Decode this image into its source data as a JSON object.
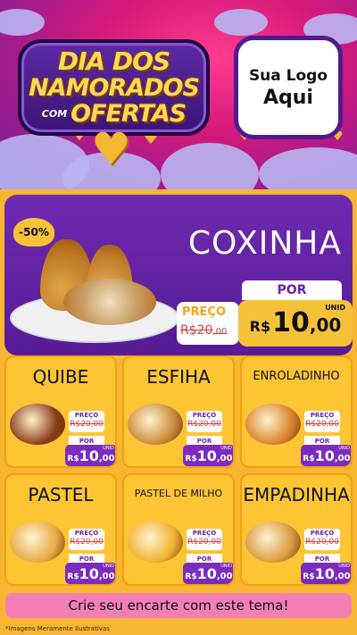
{
  "header": {
    "title_line1": "DIA DOS",
    "title_line2": "NAMORADOS",
    "title_small": "COM",
    "title_line3": "OFERTAS",
    "logo_line1": "Sua Logo",
    "logo_line2": "Aqui"
  },
  "featured": {
    "discount": "-50%",
    "name": "COXINHA",
    "preco_label": "PREÇO",
    "old_price_int": "R$20",
    "old_price_dec": ",00",
    "por_label": "POR",
    "currency": "R$",
    "new_price_int": "10",
    "new_price_dec": ",00",
    "unit": "UNID"
  },
  "products": [
    {
      "name": "QUIBE",
      "preco_label": "PREÇO",
      "old_price": "R$20,00",
      "por_label": "POR",
      "currency": "R$",
      "price_int": "10",
      "price_dec": ",00",
      "unit": "UNID",
      "food_color": "#8a3d18"
    },
    {
      "name": "ESFIHA",
      "preco_label": "PREÇO",
      "old_price": "R$20,00",
      "por_label": "POR",
      "currency": "R$",
      "price_int": "10",
      "price_dec": ",00",
      "unit": "UNID",
      "food_color": "#c98a3a"
    },
    {
      "name": "ENROLADINHO",
      "preco_label": "PREÇO",
      "old_price": "R$20,00",
      "por_label": "POR",
      "currency": "R$",
      "price_int": "10",
      "price_dec": ",00",
      "unit": "UNID",
      "food_color": "#d9822b"
    },
    {
      "name": "PASTEL",
      "preco_label": "PREÇO",
      "old_price": "R$20,00",
      "por_label": "POR",
      "currency": "R$",
      "price_int": "10",
      "price_dec": ",00",
      "unit": "UNID",
      "food_color": "#e8a845"
    },
    {
      "name": "PASTEL DE MILHO",
      "preco_label": "PREÇO",
      "old_price": "R$20,00",
      "por_label": "POR",
      "currency": "R$",
      "price_int": "10",
      "price_dec": ",00",
      "unit": "UNID",
      "food_color": "#f0b030"
    },
    {
      "name": "EMPADINHA",
      "preco_label": "PREÇO",
      "old_price": "R$20,00",
      "por_label": "POR",
      "currency": "R$",
      "price_int": "10",
      "price_dec": ",00",
      "unit": "UNID",
      "food_color": "#d99a40"
    }
  ],
  "cta": "Crie seu encarte com este tema!",
  "disclaimer": "*Imagens Meramente Ilustrativas",
  "colors": {
    "purple": "#6e2ab0",
    "yellow": "#f7c23a",
    "pink": "#f37fb5"
  }
}
